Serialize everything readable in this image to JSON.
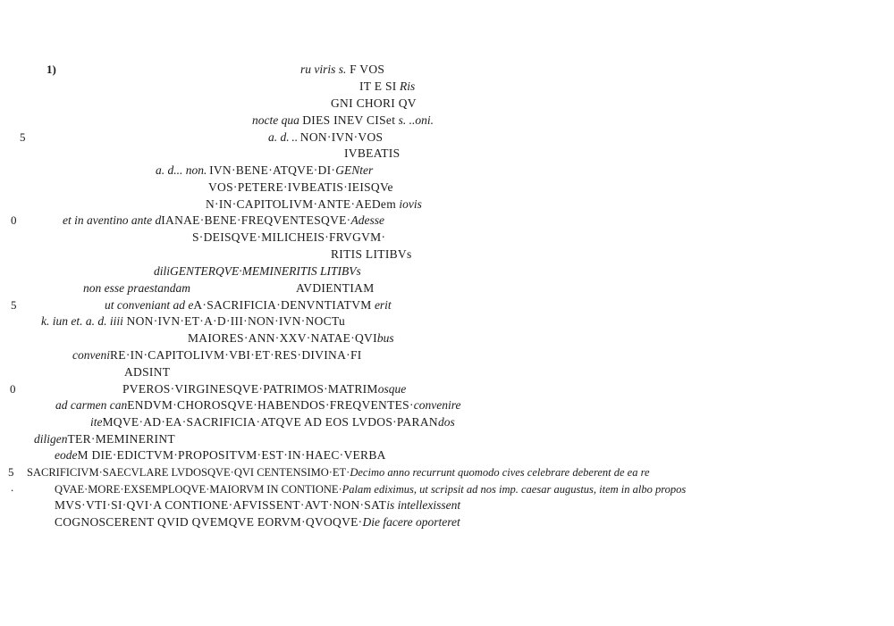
{
  "fragment_marker": "1)",
  "line_numbers": {
    "n5a": "5",
    "n0a": "0",
    "n5b": "5",
    "n0b": "0",
    "n5c": "5",
    "dot": "."
  },
  "lines": [
    {
      "it1": "ru viris s.",
      "cap": " F VOS",
      "it2": ""
    },
    {
      "it1": "",
      "cap": "IT E SI",
      "it2": " Ris"
    },
    {
      "it1": "",
      "cap": "GNI CHORI QV",
      "it2": ""
    },
    {
      "it1": "nocte qua ",
      "cap": "DIES INEV CISet",
      "it2": " s. ..oni."
    },
    {
      "it1": "a. d. .. ",
      "cap": "NON·IVN·VOS",
      "it2": ""
    },
    {
      "it1": "",
      "cap": "IVBEATIS",
      "it2": ""
    },
    {
      "it1": "a. d... non. ",
      "cap": "IVN·BENE·ATQVE·DI·",
      "it2": "GENter"
    },
    {
      "it1": "",
      "cap": "VOS·PETERE·IVBEATIS·IEISQVe",
      "it2": ""
    },
    {
      "it1": "",
      "cap": "N·IN·CAPITOLIVM·ANTE·AEDem",
      "it2": " iovis"
    },
    {
      "it1": "et in aventino ante d",
      "cap": "IANAE·BENE·FREQVENTESQVE·",
      "it2": "Adesse"
    },
    {
      "it1": "",
      "cap": "S·DEISQVE·MILICHEIS·FRVGVM·",
      "it2": ""
    },
    {
      "it1": "",
      "cap": "RITIS LITIBVs",
      "it2": ""
    },
    {
      "it1": "diliGENTERQVE·MEMINERITIS LITIBVs",
      "cap": "",
      "it2": ""
    },
    {
      "it1": "non esse praestandam",
      "cap": "AVDIENTIAM",
      "it2": ""
    },
    {
      "it1": "ut conveniant ad e",
      "cap": "A·SACRIFICIA·DENVNTIATVM",
      "it2": " erit"
    },
    {
      "it1": "k. iun et. a. d. iiii",
      "cap": " NON·IVN·ET·A·D·III·NON·IVN·NOCTu",
      "it2": ""
    },
    {
      "it1": "",
      "cap": "MAIORES·ANN·XXV·NATAE·QVI",
      "it2": "bus"
    },
    {
      "it1": "conveni",
      "cap": "RE·IN·CAPITOLIVM·VBI·ET·RES·DIVINA·FI",
      "it2": ""
    },
    {
      "it1": "",
      "cap": "ADSINT",
      "it2": ""
    },
    {
      "it1": "",
      "cap": "PVEROS·VIRGINESQVE·PATRIMOS·MATRIM",
      "it2": "osque"
    },
    {
      "it1": "ad carmen can",
      "cap": "ENDVM·CHOROSQVE·HABENDOS·FREQVENTES·",
      "it2": "convenire"
    },
    {
      "it1": "ite",
      "cap": "MQVE·AD·EA·SACRIFICIA·ATQVE AD EOS LVDOS·PARAN",
      "it2": "dos"
    },
    {
      "it1": "diligen",
      "cap": "TER·MEMINERINT",
      "it2": ""
    },
    {
      "it1": "eode",
      "cap": "M DIE·EDICTVM·PROPOSITVM·EST·IN·HAEC·VERBA",
      "it2": ""
    },
    {
      "it1": "",
      "cap": "SACRIFICIVM·SAECVLARE LVDOSQVE·QVI CENTENSIMO·ET·",
      "it2": "Decimo anno recurrunt quomodo cives celebrare deberent  de ea re"
    },
    {
      "it1": "",
      "cap": "QVAE·MORE·EXSEMPLOQVE·MAIORVM IN CONTIONE·",
      "it2": "Palam ediximus, ut scripsit ad nos imp. caesar augustus, item in albo propos"
    },
    {
      "it1": "",
      "cap": "MVS·VTI·SI·QVI·A CONTIONE·AFVISSENT·AVT·NON·SAT",
      "it2": "is intellexissent"
    },
    {
      "it1": "",
      "cap": "COGNOSCERENT QVID QVEMQVE EORVM·QVOQVE·",
      "it2": "Die facere oporteret"
    }
  ]
}
